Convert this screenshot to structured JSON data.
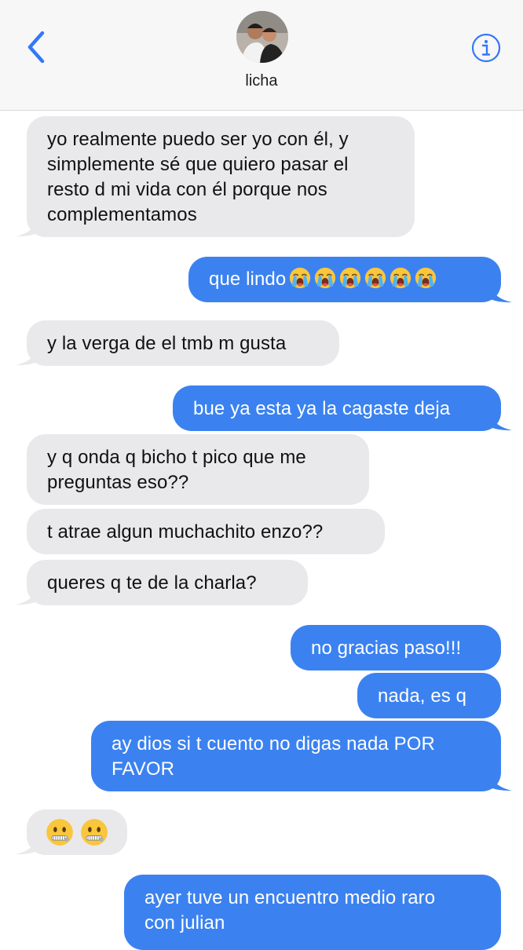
{
  "header": {
    "contact_name": "licha",
    "back_icon": "chevron-left-icon",
    "info_icon": "info-icon",
    "accent": "#3478f6"
  },
  "colors": {
    "incoming_bubble": "#e9e9eb",
    "outgoing_bubble": "#3b82f0",
    "incoming_text": "#111111",
    "outgoing_text": "#ffffff"
  },
  "messages": [
    {
      "direction": "incoming",
      "lines": [
        "yo realmente puedo ser yo con él, y",
        "simplemente sé que quiero pasar el",
        "resto d mi vida con él porque nos",
        "complementamos"
      ]
    },
    {
      "direction": "outgoing",
      "text": "que lindo",
      "emoji": "loudly-crying-face",
      "emoji_count": 6
    },
    {
      "direction": "incoming",
      "text": "y la verga de el tmb m gusta"
    },
    {
      "direction": "outgoing",
      "text": "bue ya esta ya la cagaste deja"
    },
    {
      "direction": "incoming",
      "lines": [
        "y q onda q bicho t pico que me",
        "preguntas eso??"
      ]
    },
    {
      "direction": "incoming",
      "text": "t atrae algun muchachito enzo??"
    },
    {
      "direction": "incoming",
      "text": "queres q te de la charla?"
    },
    {
      "direction": "outgoing",
      "text": "no gracias paso!!!"
    },
    {
      "direction": "outgoing",
      "text": "nada, es q"
    },
    {
      "direction": "outgoing",
      "lines": [
        "ay dios si t cuento no digas nada POR",
        "FAVOR"
      ]
    },
    {
      "direction": "incoming",
      "emoji": "zipper-mouth-face",
      "emoji_count": 2
    },
    {
      "direction": "outgoing",
      "lines": [
        "ayer tuve un encuentro medio raro",
        "con julian"
      ]
    }
  ]
}
